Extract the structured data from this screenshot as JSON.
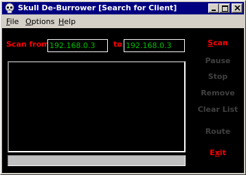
{
  "window": {
    "title": "Skull De-Burrower [Search for Client]"
  },
  "menu": {
    "items": [
      {
        "key": "F",
        "rest": "ile"
      },
      {
        "key": "O",
        "rest": "ptions"
      },
      {
        "key": "H",
        "rest": "elp"
      }
    ]
  },
  "scan": {
    "from_label": "Scan from",
    "to_label": "to",
    "start_ip": "192.168.0.3",
    "end_ip": "192.168.0.3"
  },
  "actions": {
    "scan": {
      "key": "S",
      "rest": "can"
    },
    "pause": "Pause",
    "stop": "Stop",
    "remove": "Remove",
    "clear_list": "Clear List",
    "route": "Route",
    "exit": {
      "key": "x",
      "before": "E",
      "after": "it"
    }
  },
  "colors": {
    "title_bar": "#000080",
    "label_red": "#ff0000",
    "ip_text": "#00c000",
    "disabled": "#404040",
    "background": "#000000"
  },
  "icons": {
    "app": "skull-icon",
    "minimize": "minimize-icon",
    "maximize": "maximize-icon",
    "close": "close-icon"
  }
}
